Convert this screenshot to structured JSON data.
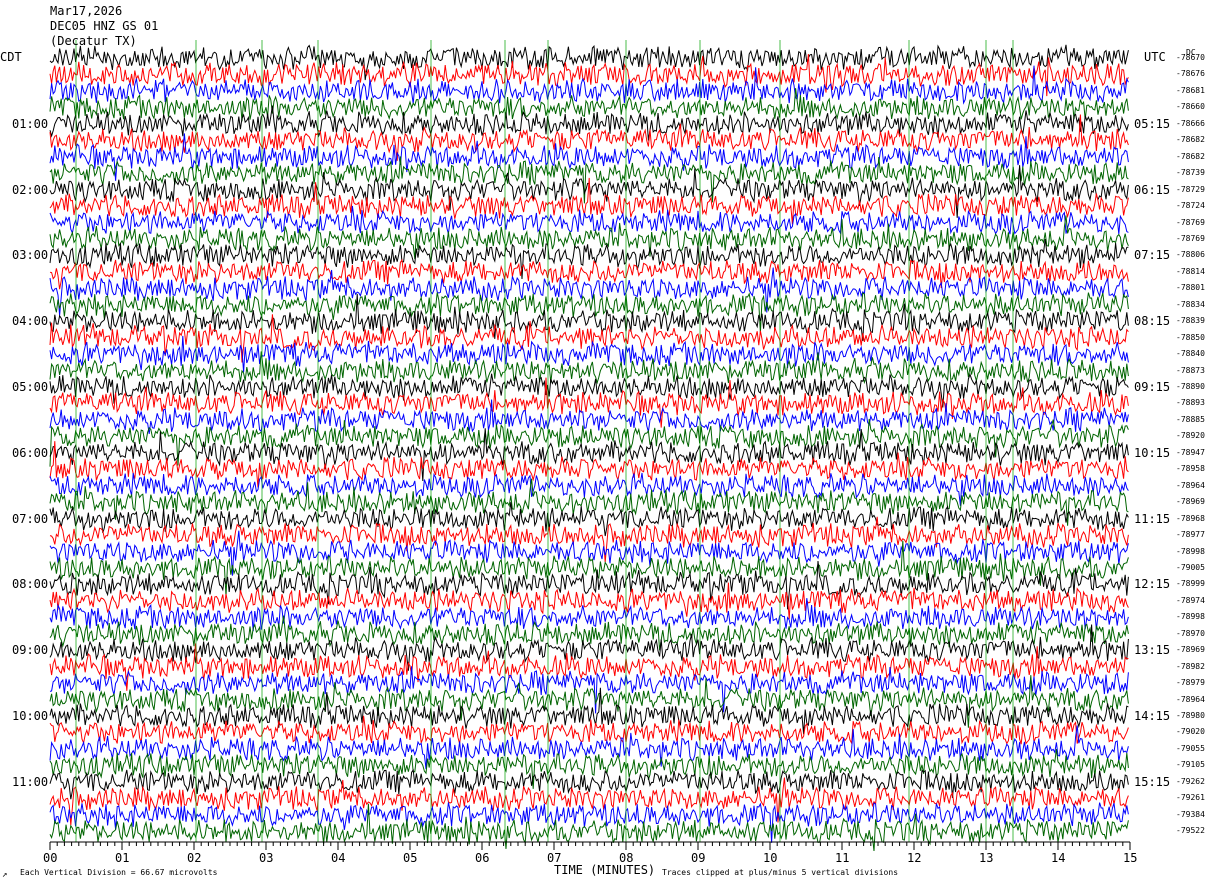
{
  "header": {
    "date": "Mar17,2026",
    "station": "DEC05 HNZ GS 01",
    "location": "(Decatur TX)"
  },
  "left_timezone": "CDT",
  "right_timezone": "UTC",
  "right_top_label": "DC",
  "footer": {
    "scale_note": "Each Vertical Division =   66.67 microvolts",
    "clip_note": "Traces clipped at plus/minus 5 vertical divisions",
    "corner_mark": "↗"
  },
  "colors": {
    "black": "#000000",
    "red": "#ff0000",
    "blue": "#0000ff",
    "green": "#006400",
    "axis": "#000000",
    "grid": "#00a000"
  },
  "chart_data": {
    "type": "line",
    "title": "",
    "xlabel": "TIME (MINUTES)",
    "ylabel": "",
    "xlim": [
      0,
      15
    ],
    "x_ticks": [
      "00",
      "01",
      "02",
      "03",
      "04",
      "05",
      "06",
      "07",
      "08",
      "09",
      "10",
      "11",
      "12",
      "13",
      "14",
      "15"
    ],
    "minutes_per_line": 15,
    "traces_per_hour": 4,
    "trace_color_cycle": [
      "black",
      "red",
      "blue",
      "green"
    ],
    "left_hour_labels": [
      "01:00",
      "02:00",
      "03:00",
      "04:00",
      "05:00",
      "06:00",
      "07:00",
      "08:00",
      "09:00",
      "10:00",
      "11:00"
    ],
    "right_hour_labels": [
      "05:15",
      "06:15",
      "07:15",
      "08:15",
      "09:15",
      "10:15",
      "11:15",
      "12:15",
      "13:15",
      "14:15",
      "15:15"
    ],
    "dc_offsets": [
      "-78670",
      "-78676",
      "-78681",
      "-78660",
      "-78666",
      "-78682",
      "-78682",
      "-78739",
      "-78729",
      "-78724",
      "-78769",
      "-78769",
      "-78806",
      "-78814",
      "-78801",
      "-78834",
      "-78839",
      "-78850",
      "-78840",
      "-78873",
      "-78890",
      "-78893",
      "-78885",
      "-78920",
      "-78947",
      "-78958",
      "-78964",
      "-78969",
      "-78968",
      "-78977",
      "-78998",
      "-79005",
      "-78999",
      "-78974",
      "-78998",
      "-78970",
      "-78969",
      "-78982",
      "-78979",
      "-78964",
      "-78980",
      "-79020",
      "-79055",
      "-79105",
      "-79262",
      "-79261",
      "-79384",
      "-79522"
    ],
    "num_traces": 48
  }
}
